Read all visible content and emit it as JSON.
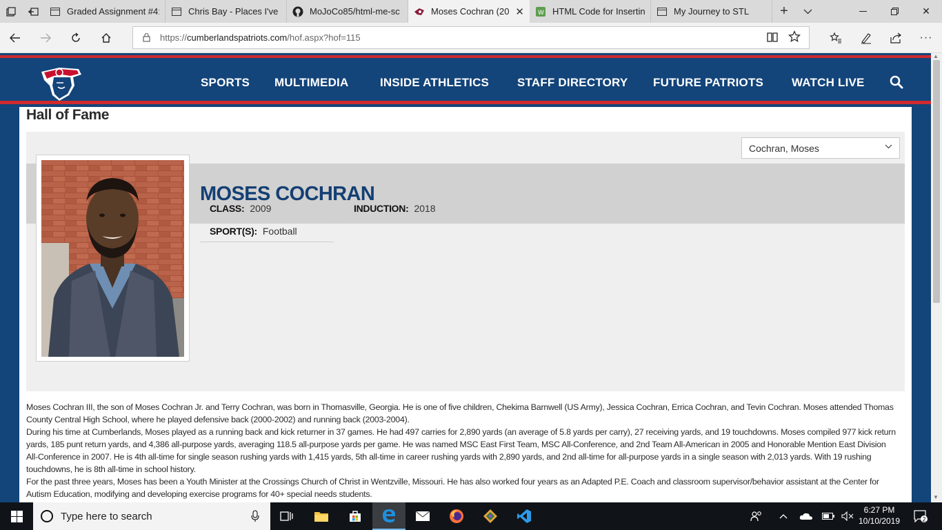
{
  "browser": {
    "tabs": [
      {
        "title": "Graded Assignment #4:"
      },
      {
        "title": "Chris Bay - Places I've li"
      },
      {
        "title": "MoJoCo85/html-me-sc"
      },
      {
        "title": "Moses Cochran (20"
      },
      {
        "title": "HTML Code for Insertin"
      },
      {
        "title": "My Journey to STL"
      }
    ],
    "url_prefix": "https://",
    "url_host": "cumberlandspatriots.com",
    "url_path": "/hof.aspx?hof=115"
  },
  "site": {
    "nav": [
      "SPORTS",
      "MULTIMEDIA",
      "INSIDE ATHLETICS",
      "STAFF DIRECTORY",
      "FUTURE PATRIOTS",
      "WATCH LIVE"
    ],
    "accent_red": "#d02a2e",
    "brand_navy": "#13447a"
  },
  "hof": {
    "page_title": "Hall of Fame",
    "selector_value": "Cochran, Moses",
    "name": "MOSES COCHRAN",
    "class_label": "CLASS:",
    "class_value": "2009",
    "induction_label": "INDUCTION:",
    "induction_value": "2018",
    "sport_label": "SPORT(S):",
    "sport_value": "Football",
    "bio": [
      "Moses Cochran III, the son of Moses Cochran Jr. and Terry Cochran, was born in Thomasville, Georgia. He is one of five children, Chekima Barnwell (US Army), Jessica Cochran, Errica Cochran, and Tevin Cochran. Moses attended Thomas County Central High School, where he played defensive back (2000-2002) and running back (2003-2004).",
      "During his time at Cumberlands, Moses played as a running back and kick returner in 37 games. He had 497 carries for 2,890 yards (an average of 5.8 yards per carry), 27 receiving yards, and 19 touchdowns. Moses compiled 977 kick return yards, 185 punt return yards, and 4,386 all-purpose yards, averaging 118.5 all-purpose yards per game. He was named MSC East First Team, MSC All-Conference, and 2nd Team All-American in 2005 and Honorable Mention East Division All-Conference in 2007. He is 4th all-time for single season rushing yards with 1,415 yards, 5th all-time in career rushing yards with 2,890 yards, and 2nd all-time for all-purpose yards in a single season with 2,013 yards. With 19 rushing touchdowns, he is 8th all-time in school history.",
      "For the past three years, Moses has been a Youth Minister at the Crossings Church of Christ in Wentzville, Missouri. He has also worked four years as an Adapted P.E. Coach and classroom supervisor/behavior assistant at the Center for Autism Education, modifying and developing exercise programs for 40+ special needs students."
    ]
  },
  "taskbar": {
    "search_placeholder": "Type here to search",
    "time": "6:27 PM",
    "date": "10/10/2019",
    "notification_count": "2"
  }
}
